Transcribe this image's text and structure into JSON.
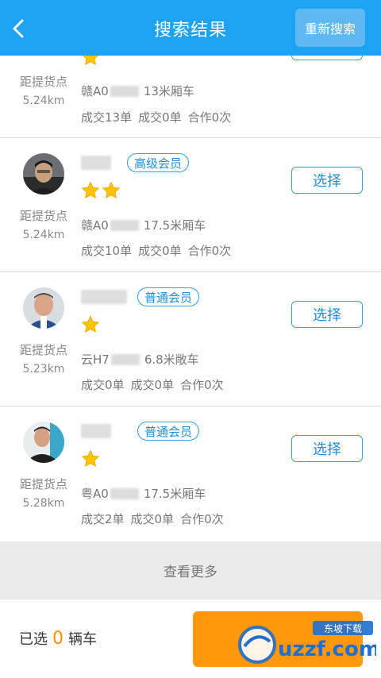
{
  "header": {
    "title": "搜索结果",
    "research_label": "重新搜索"
  },
  "items": [
    {
      "distance_label": "距提货点",
      "distance": "5.24km",
      "vehicle_prefix": "赣A0",
      "vehicle_desc": "13米厢车",
      "stats": [
        "成交13单",
        "成交0单",
        "合作0次"
      ],
      "stars": 1
    },
    {
      "distance_label": "距提货点",
      "distance": "5.24km",
      "badge": "高级会员",
      "vehicle_prefix": "赣A0",
      "vehicle_desc": "17.5米厢车",
      "stats": [
        "成交10单",
        "成交0单",
        "合作0次"
      ],
      "stars": 2,
      "select_label": "选择"
    },
    {
      "distance_label": "距提货点",
      "distance": "5.23km",
      "badge": "普通会员",
      "vehicle_prefix": "云H7",
      "vehicle_desc": "6.8米敞车",
      "stats": [
        "成交0单",
        "成交0单",
        "合作0次"
      ],
      "stars": 1,
      "select_label": "选择"
    },
    {
      "distance_label": "距提货点",
      "distance": "5.28km",
      "badge": "普通会员",
      "vehicle_prefix": "粤A0",
      "vehicle_desc": "17.5米厢车",
      "stats": [
        "成交2单",
        "成交0单",
        "合作0次"
      ],
      "stars": 1,
      "select_label": "选择"
    }
  ],
  "more_label": "查看更多",
  "footer": {
    "selected_prefix": "已选",
    "selected_count": "0",
    "selected_suffix": "辆车"
  },
  "watermark": {
    "brand": "uzzf.com",
    "tag": "东坡下载"
  },
  "colors": {
    "header": "#1ea2f2",
    "accent": "#2da3ee",
    "orange": "#ff9200",
    "star": "#ffc400"
  }
}
